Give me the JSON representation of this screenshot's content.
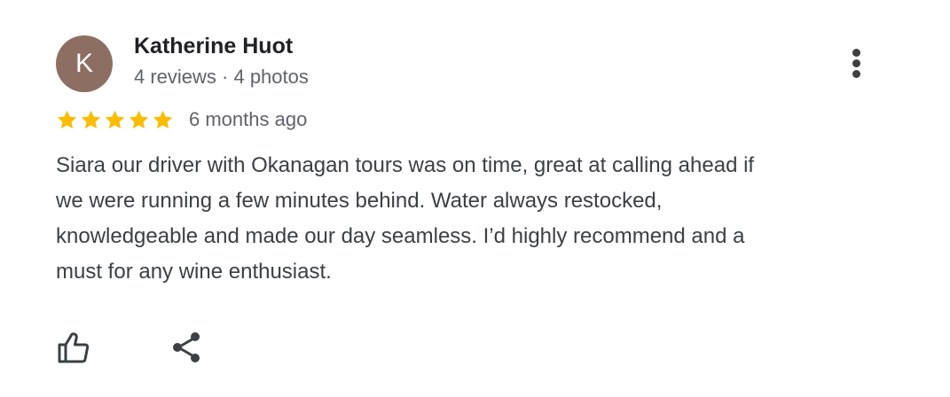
{
  "review": {
    "avatar_letter": "K",
    "reviewer_name": "Katherine Huot",
    "reviewer_meta": "4 reviews · 4 photos",
    "rating": 5,
    "rating_max": 5,
    "date": "6 months ago",
    "text_lines": [
      "Siara our driver with Okanagan tours was on time, great at calling ahead if",
      "we were running a few minutes behind. Water always restocked,",
      "knowledgeable and made our day seamless. I’d highly recommend and a",
      "must for any wine enthusiast."
    ]
  },
  "icons": {
    "more": "more-vert-icon",
    "star": "star-icon",
    "like": "thumb-up-icon",
    "share": "share-icon"
  },
  "colors": {
    "avatar_bg": "#8d6e63",
    "star": "#fbbc04",
    "muted_text": "#5f6368",
    "body_text": "#3c4043"
  }
}
